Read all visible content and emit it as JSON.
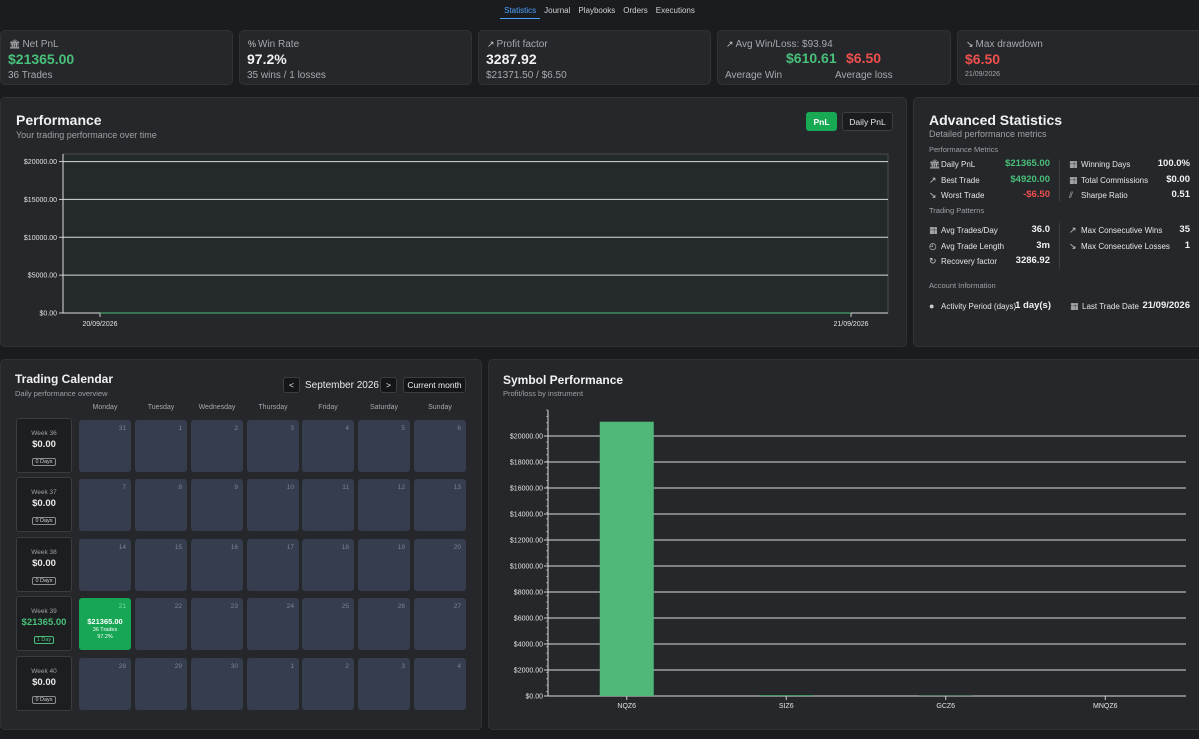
{
  "nav": {
    "tabs": [
      "Statistics",
      "Journal",
      "Playbooks",
      "Orders",
      "Executions"
    ]
  },
  "stats": {
    "net_pnl": {
      "label": "Net PnL",
      "value": "$21365.00",
      "sub": "36 Trades"
    },
    "win_rate": {
      "label": "Win Rate",
      "value": "97.2%",
      "sub": "35 wins / 1 losses"
    },
    "profit_factor": {
      "label": "Profit factor",
      "value": "3287.92",
      "sub": "$21371.50 / $6.50"
    },
    "avg_win_loss": {
      "label": "Avg Win/Loss: $93.94",
      "win": "$610.61",
      "loss": "$6.50",
      "win_label": "Average Win",
      "loss_label": "Average loss"
    },
    "max_drawdown": {
      "label": "Max drawdown",
      "value": "$6.50",
      "sub": "21/09/2026"
    }
  },
  "performance": {
    "title": "Performance",
    "subtitle": "Your trading performance over time",
    "btn_pnl": "PnL",
    "btn_daily": "Daily PnL",
    "chart_data": {
      "type": "line",
      "x": [
        "20/09/2026",
        "21/09/2026"
      ],
      "series": [
        {
          "values": [
            0,
            0
          ]
        }
      ],
      "yticks": [
        "$20000.00",
        "$15000.00",
        "$10000.00",
        "$5000.00",
        "$0.00"
      ],
      "ylim": [
        0,
        21000
      ]
    }
  },
  "advanced": {
    "title": "Advanced Statistics",
    "subtitle": "Detailed performance metrics",
    "sec_metrics": "Performance Metrics",
    "sec_patterns": "Trading Patterns",
    "sec_account": "Account Information",
    "metrics_left": [
      {
        "icon": "bank-icon",
        "label": "Daily PnL",
        "value": "$21365.00",
        "color": "#49c07a"
      },
      {
        "icon": "trend-up-icon",
        "label": "Best Trade",
        "value": "$4920.00",
        "color": "#49c07a"
      },
      {
        "icon": "trend-down-icon",
        "label": "Worst Trade",
        "value": "-$6.50",
        "color": "#ef4f4f"
      }
    ],
    "metrics_right": [
      {
        "icon": "calendar-icon",
        "label": "Winning Days",
        "value": "100.0%"
      },
      {
        "icon": "calendar-icon",
        "label": "Total Commissions",
        "value": "$0.00"
      },
      {
        "icon": "chart-icon",
        "label": "Sharpe Ratio",
        "value": "0.51"
      }
    ],
    "patterns_left": [
      {
        "icon": "calendar-icon",
        "label": "Avg Trades/Day",
        "value": "36.0"
      },
      {
        "icon": "clock-icon",
        "label": "Avg Trade Length",
        "value": "3m"
      },
      {
        "icon": "refresh-icon",
        "label": "Recovery factor",
        "value": "3286.92"
      }
    ],
    "patterns_right": [
      {
        "icon": "trend-up-icon",
        "label": "Max Consecutive Wins",
        "value": "35"
      },
      {
        "icon": "trend-down-icon",
        "label": "Max Consecutive Losses",
        "value": "1"
      }
    ],
    "account": [
      {
        "icon": "circle-icon",
        "label": "Activity Period (days)",
        "value": "1 day(s)"
      },
      {
        "icon": "calendar-icon",
        "label": "Last Trade Date",
        "value": "21/09/2026"
      }
    ]
  },
  "calendar": {
    "title": "Trading Calendar",
    "subtitle": "Daily performance overview",
    "month": "September 2026",
    "prev": "<",
    "next": ">",
    "current": "Current month",
    "daynames": [
      "Monday",
      "Tuesday",
      "Wednesday",
      "Thursday",
      "Friday",
      "Saturday",
      "Sunday"
    ],
    "weeks": [
      {
        "label": "Week 36",
        "value": "$0.00",
        "days": "0 Days",
        "dates": [
          "31",
          "1",
          "2",
          "3",
          "4",
          "5",
          "6"
        ]
      },
      {
        "label": "Week 37",
        "value": "$0.00",
        "days": "0 Days",
        "dates": [
          "7",
          "8",
          "9",
          "10",
          "11",
          "12",
          "13"
        ]
      },
      {
        "label": "Week 38",
        "value": "$0.00",
        "days": "0 Days",
        "dates": [
          "14",
          "15",
          "16",
          "17",
          "18",
          "19",
          "20"
        ]
      },
      {
        "label": "Week 39",
        "value": "$21365.00",
        "days": "1 Day",
        "dates": [
          "21",
          "22",
          "23",
          "24",
          "25",
          "26",
          "27"
        ]
      },
      {
        "label": "Week 40",
        "value": "$0.00",
        "days": "0 Days",
        "dates": [
          "28",
          "29",
          "30",
          "1",
          "2",
          "3",
          "4"
        ]
      }
    ],
    "active_day": {
      "value": "$21365.00",
      "trades": "36 Trades",
      "rate": "97.2%"
    }
  },
  "symbol": {
    "title": "Symbol Performance",
    "subtitle": "Profit/loss by instrument",
    "chart_data": {
      "type": "bar",
      "categories": [
        "NQZ6",
        "SIZ6",
        "GCZ6",
        "MNQZ6"
      ],
      "values": [
        21100,
        60,
        20,
        0
      ],
      "yticks": [
        "$20000.00",
        "$18000.00",
        "$16000.00",
        "$14000.00",
        "$12000.00",
        "$10000.00",
        "$8000.00",
        "$6000.00",
        "$4000.00",
        "$2000.00",
        "$0.00"
      ],
      "ylim": [
        0,
        22000
      ],
      "color": "#4fb879"
    }
  }
}
